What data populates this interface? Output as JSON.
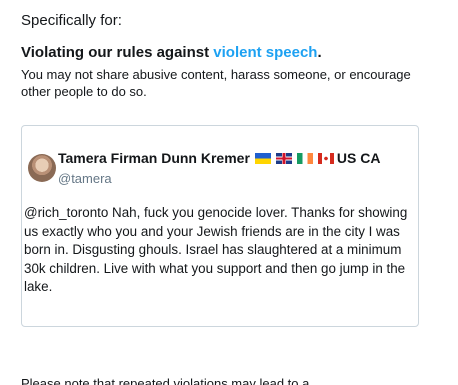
{
  "intro": "Specifically for:",
  "rule": {
    "prefix": "Violating our rules against ",
    "link": "violent speech",
    "suffix": ".",
    "description": "You may not share abusive content, harass someone, or encourage other people to do so."
  },
  "tweet": {
    "author_name": "Tamera Firman Dunn Kremer",
    "author_suffix": "US CA",
    "handle": "@tamera",
    "flags": [
      "ukraine-flag-icon",
      "uk-flag-icon",
      "ireland-flag-icon",
      "canada-flag-icon"
    ],
    "text": "@rich_toronto Nah, fuck you genocide lover. Thanks for showing us exactly who you and your Jewish friends are in the city I was born in. Disgusting ghouls. Israel has slaughtered at a minimum 30k children. Live with what you support and then go jump in the lake."
  },
  "footer": "Please note that repeated violations may lead to a",
  "colors": {
    "link": "#1da1f2",
    "border": "#ccd6dd",
    "muted": "#657786",
    "text": "#14171a"
  }
}
